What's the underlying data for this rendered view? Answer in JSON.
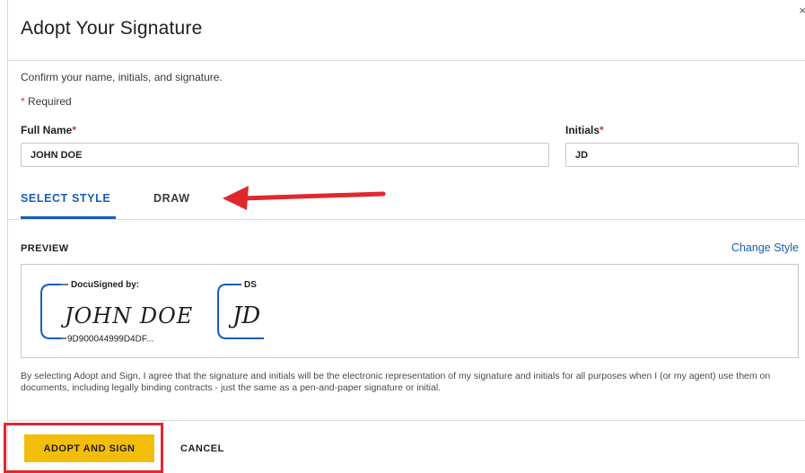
{
  "dialog": {
    "title": "Adopt Your Signature",
    "close_glyph": "×",
    "confirm_text": "Confirm your name, initials, and signature.",
    "required_star": "*",
    "required_text": " Required"
  },
  "fields": {
    "full_name_label": "Full Name",
    "full_name_value": "JOHN DOE",
    "initials_label": "Initials",
    "initials_value": "JD",
    "required_marker": "*"
  },
  "tabs": [
    {
      "label": "SELECT STYLE",
      "active": true
    },
    {
      "label": "DRAW",
      "active": false
    }
  ],
  "preview": {
    "label": "PREVIEW",
    "change_style_link": "Change Style",
    "signature": {
      "header": "DocuSigned by:",
      "name": "JOHN DOE",
      "envelope_id": "9D900044999D4DF..."
    },
    "initials": {
      "header": "DS",
      "text": "JD"
    }
  },
  "disclaimer": "By selecting Adopt and Sign, I agree that the signature and initials will be the electronic representation of my signature and initials for all purposes when I (or my agent) use them on documents, including legally binding contracts - just the same as a pen-and-paper signature or initial.",
  "footer": {
    "adopt_label": "ADOPT AND SIGN",
    "cancel_label": "CANCEL"
  },
  "colors": {
    "accent_blue": "#1a5cb8",
    "adopt_button": "#f3bd0c",
    "annotation_red": "#e0282e",
    "required_red": "#d0342c"
  }
}
